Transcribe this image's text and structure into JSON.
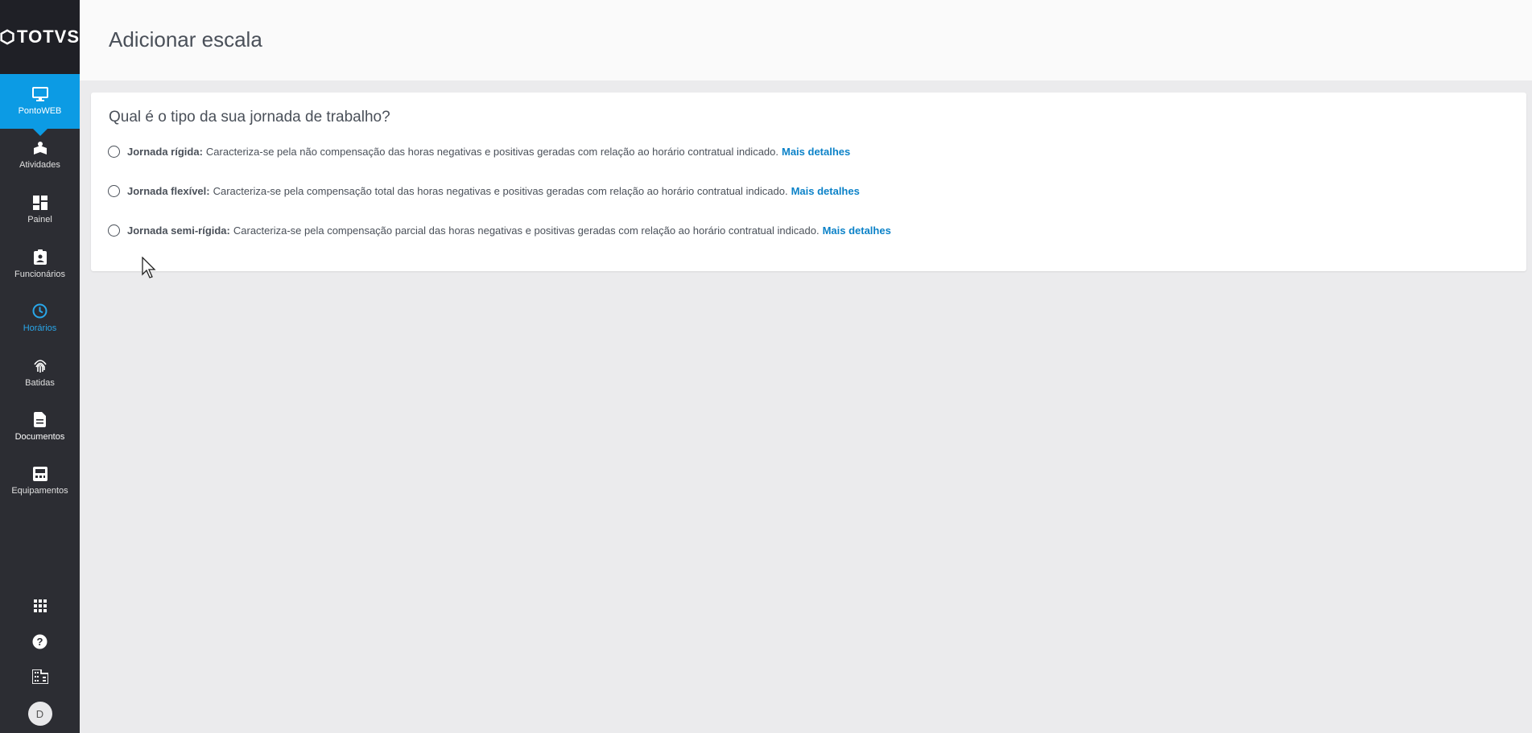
{
  "app": {
    "logo_text": "TOTVS",
    "brand_color": "#0c9be4",
    "sidebar_color": "#2c2d33",
    "link_color": "#0c82c8"
  },
  "sidebar": {
    "items": [
      {
        "label": "PontoWEB",
        "icon": "monitor-icon",
        "state": "active-app"
      },
      {
        "label": "Atividades",
        "icon": "activities-icon",
        "state": "normal"
      },
      {
        "label": "Painel",
        "icon": "dashboard-icon",
        "state": "normal"
      },
      {
        "label": "Funcionários",
        "icon": "badge-icon",
        "state": "normal"
      },
      {
        "label": "Horários",
        "icon": "clock-icon",
        "state": "selected"
      },
      {
        "label": "Batidas",
        "icon": "fingerprint-icon",
        "state": "normal"
      },
      {
        "label": "Documentos",
        "icon": "document-icon",
        "state": "bold"
      },
      {
        "label": "Equipamentos",
        "icon": "device-icon",
        "state": "normal"
      }
    ],
    "bottom": {
      "icons": [
        "apps-grid-icon",
        "help-icon",
        "building-icon"
      ],
      "avatar_initial": "D"
    }
  },
  "header": {
    "title": "Adicionar escala"
  },
  "card": {
    "question": "Qual é o tipo da sua jornada de trabalho?",
    "options": [
      {
        "title": "Jornada rígida:",
        "description": "Caracteriza-se pela não compensação das horas negativas e positivas geradas com relação ao horário contratual indicado.",
        "link": "Mais detalhes",
        "selected": false
      },
      {
        "title": "Jornada flexível:",
        "description": "Caracteriza-se pela compensação total das horas negativas e positivas geradas com relação ao horário contratual indicado.",
        "link": "Mais detalhes",
        "selected": false
      },
      {
        "title": "Jornada semi-rígida:",
        "description": "Caracteriza-se pela compensação parcial das horas negativas e positivas geradas com relação ao horário contratual indicado.",
        "link": "Mais detalhes",
        "selected": false
      }
    ]
  }
}
